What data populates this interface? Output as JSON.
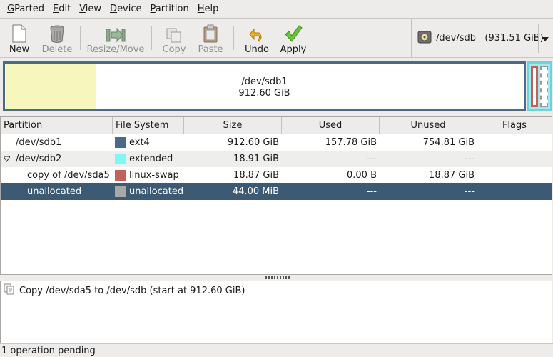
{
  "menubar": {
    "items": [
      {
        "label": "GParted",
        "mnemonic": "G",
        "rest": "Parted"
      },
      {
        "label": "Edit",
        "mnemonic": "E",
        "rest": "dit"
      },
      {
        "label": "View",
        "mnemonic": "V",
        "rest": "iew"
      },
      {
        "label": "Device",
        "mnemonic": "D",
        "rest": "evice"
      },
      {
        "label": "Partition",
        "mnemonic": "P",
        "rest": "artition"
      },
      {
        "label": "Help",
        "mnemonic": "H",
        "rest": "elp"
      }
    ]
  },
  "toolbar": {
    "new_label": "New",
    "delete_label": "Delete",
    "resize_label": "Resize/Move",
    "copy_label": "Copy",
    "paste_label": "Paste",
    "undo_label": "Undo",
    "apply_label": "Apply",
    "device": "/dev/sdb   (931.51 GiB)"
  },
  "diskmap": {
    "main_name": "/dev/sdb1",
    "main_size": "912.60 GiB",
    "colors": {
      "used": "#f7f6bd",
      "ext4": "#4a6a8a",
      "extended": "#67d6dc",
      "swap": "#c1625a"
    }
  },
  "table": {
    "columns": [
      "Partition",
      "File System",
      "Size",
      "Used",
      "Unused",
      "Flags"
    ],
    "rows": [
      {
        "partition": "/dev/sdb1",
        "filesystem": "ext4",
        "size": "912.60 GiB",
        "used": "157.78 GiB",
        "unused": "754.81 GiB",
        "flags": "",
        "color": "#4a6a8a"
      },
      {
        "partition": "/dev/sdb2",
        "filesystem": "extended",
        "size": "18.91 GiB",
        "used": "---",
        "unused": "---",
        "flags": "",
        "color": "#7ff7f7"
      },
      {
        "partition": "copy of /dev/sda5",
        "filesystem": "linux-swap",
        "size": "18.87 GiB",
        "used": "0.00 B",
        "unused": "18.87 GiB",
        "flags": "",
        "color": "#c1625a"
      },
      {
        "partition": "unallocated",
        "filesystem": "unallocated",
        "size": "44.00 MiB",
        "used": "---",
        "unused": "---",
        "flags": "",
        "color": "#a8a8a8"
      }
    ]
  },
  "operations": {
    "items": [
      "Copy /dev/sda5 to /dev/sdb (start at 912.60 GiB)"
    ]
  },
  "status": "1 operation pending"
}
